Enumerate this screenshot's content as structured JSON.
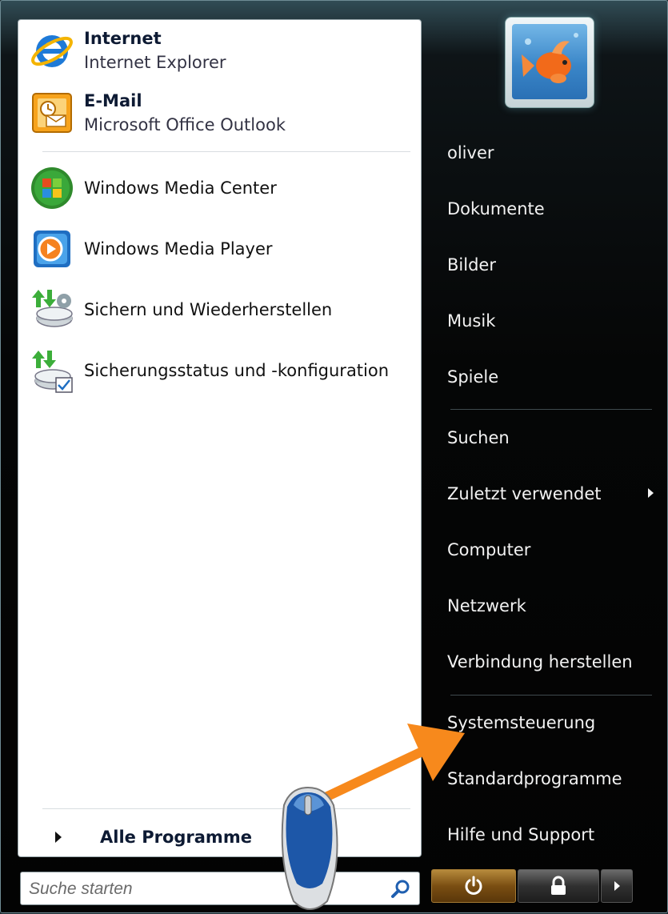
{
  "pinned": [
    {
      "title": "Internet",
      "subtitle": "Internet Explorer",
      "icon": "internet-explorer-icon"
    },
    {
      "title": "E-Mail",
      "subtitle": "Microsoft Office Outlook",
      "icon": "outlook-icon"
    }
  ],
  "recent": [
    {
      "label": "Windows Media Center",
      "icon": "media-center-icon"
    },
    {
      "label": "Windows Media Player",
      "icon": "media-player-icon"
    },
    {
      "label": "Sichern und Wiederherstellen",
      "icon": "backup-restore-icon"
    },
    {
      "label": "Sicherungsstatus und -konfiguration",
      "icon": "backup-status-icon"
    }
  ],
  "all_programs_label": "Alle Programme",
  "search": {
    "placeholder": "Suche starten"
  },
  "right_items": [
    {
      "label": "oliver"
    },
    {
      "label": "Dokumente"
    },
    {
      "label": "Bilder"
    },
    {
      "label": "Musik"
    },
    {
      "label": "Spiele"
    },
    {
      "label": "Suchen"
    },
    {
      "label": "Zuletzt verwendet"
    },
    {
      "label": "Computer"
    },
    {
      "label": "Netzwerk"
    },
    {
      "label": "Verbindung herstellen"
    },
    {
      "label": "Systemsteuerung"
    },
    {
      "label": "Standardprogramme"
    },
    {
      "label": "Hilfe und Support"
    }
  ],
  "colors": {
    "accent_arrow": "#f7891c",
    "menu_bg": "#050606",
    "text_light": "#f2f2f2"
  }
}
